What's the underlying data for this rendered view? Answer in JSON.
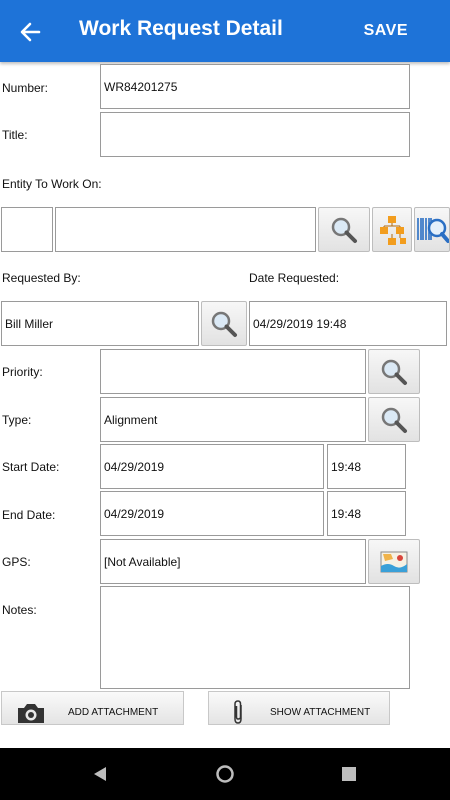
{
  "header": {
    "title": "Work Request Detail",
    "save_label": "SAVE"
  },
  "form": {
    "number_label": "Number:",
    "number_value": "WR84201275",
    "title_label": "Title:",
    "title_value": "",
    "entity_label": "Entity To Work On:",
    "entity_code_value": "",
    "entity_value": "",
    "requested_by_label": "Requested By:",
    "requested_by_value": "Bill Miller",
    "date_requested_label": "Date Requested:",
    "date_requested_value": "04/29/2019 19:48",
    "priority_label": "Priority:",
    "priority_value": "",
    "type_label": "Type:",
    "type_value": "Alignment",
    "start_date_label": "Start Date:",
    "start_date_value": "04/29/2019",
    "start_time_value": "19:48",
    "end_date_label": "End Date:",
    "end_date_value": "04/29/2019",
    "end_time_value": "19:48",
    "gps_label": "GPS:",
    "gps_value": "[Not Available]",
    "notes_label": "Notes:",
    "notes_value": ""
  },
  "attachments": {
    "add_label": "ADD ATTACHMENT",
    "show_label": "SHOW ATTACHMENT"
  },
  "colors": {
    "appbar": "#1e73d8",
    "navbar": "#000000"
  },
  "icons": {
    "back": "arrow-left-icon",
    "lookup": "magnifier-icon",
    "hierarchy": "hierarchy-icon",
    "barcode": "barcode-search-icon",
    "map": "map-icon",
    "camera": "camera-icon",
    "paperclip": "paperclip-icon"
  }
}
